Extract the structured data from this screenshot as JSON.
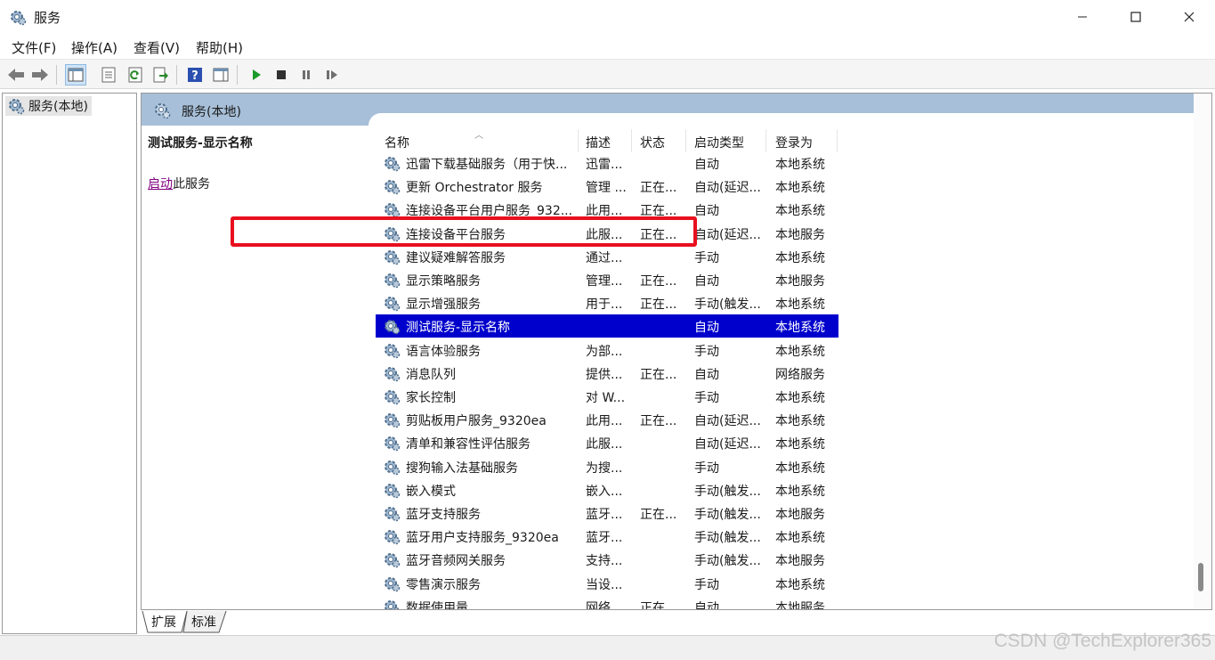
{
  "window": {
    "title": "服务"
  },
  "menu": [
    {
      "label": "文件(F)"
    },
    {
      "label": "操作(A)"
    },
    {
      "label": "查看(V)"
    },
    {
      "label": "帮助(H)"
    }
  ],
  "toolbar": {
    "icons": [
      "back-arrow-icon",
      "forward-arrow-icon",
      "show-hide-tree-icon",
      "properties-icon",
      "refresh-icon",
      "export-list-icon",
      "help-icon",
      "show-console-icon",
      "start-service-icon",
      "stop-service-icon",
      "pause-service-icon",
      "restart-service-icon"
    ],
    "colors": {
      "start": "#1a9a2a",
      "stop": "#303030",
      "help": "#2a4fb0"
    }
  },
  "tree": {
    "root_label": "服务(本地)"
  },
  "content": {
    "header_title": "服务(本地)",
    "selected_title": "测试服务-显示名称",
    "action_link": "启动",
    "action_suffix": "此服务"
  },
  "table": {
    "columns": [
      "名称",
      "描述",
      "状态",
      "启动类型",
      "登录为"
    ],
    "rows": [
      {
        "name": "迅雷下载基础服务（用于快...",
        "desc": "迅雷...",
        "status": "",
        "startup": "自动",
        "logon": "本地系统"
      },
      {
        "name": "更新 Orchestrator 服务",
        "desc": "管理 ...",
        "status": "正在...",
        "startup": "自动(延迟...",
        "logon": "本地系统"
      },
      {
        "name": "连接设备平台用户服务_932...",
        "desc": "此用...",
        "status": "正在...",
        "startup": "自动",
        "logon": "本地系统"
      },
      {
        "name": "连接设备平台服务",
        "desc": "此服...",
        "status": "正在...",
        "startup": "自动(延迟...",
        "logon": "本地服务"
      },
      {
        "name": "建议疑难解答服务",
        "desc": "通过...",
        "status": "",
        "startup": "手动",
        "logon": "本地系统"
      },
      {
        "name": "显示策略服务",
        "desc": "管理...",
        "status": "正在...",
        "startup": "自动",
        "logon": "本地服务"
      },
      {
        "name": "显示增强服务",
        "desc": "用于...",
        "status": "正在...",
        "startup": "手动(触发...",
        "logon": "本地系统"
      },
      {
        "name": "测试服务-显示名称",
        "desc": "",
        "status": "",
        "startup": "自动",
        "logon": "本地系统",
        "selected": true
      },
      {
        "name": "语言体验服务",
        "desc": "为部...",
        "status": "",
        "startup": "手动",
        "logon": "本地系统"
      },
      {
        "name": "消息队列",
        "desc": "提供...",
        "status": "正在...",
        "startup": "自动",
        "logon": "网络服务"
      },
      {
        "name": "家长控制",
        "desc": "对 W...",
        "status": "",
        "startup": "手动",
        "logon": "本地系统"
      },
      {
        "name": "剪贴板用户服务_9320ea",
        "desc": "此用...",
        "status": "正在...",
        "startup": "自动(延迟...",
        "logon": "本地系统"
      },
      {
        "name": "清单和兼容性评估服务",
        "desc": "此服...",
        "status": "",
        "startup": "自动(延迟...",
        "logon": "本地系统"
      },
      {
        "name": "搜狗输入法基础服务",
        "desc": "为搜...",
        "status": "",
        "startup": "手动",
        "logon": "本地系统"
      },
      {
        "name": "嵌入模式",
        "desc": "嵌入...",
        "status": "",
        "startup": "手动(触发...",
        "logon": "本地系统"
      },
      {
        "name": "蓝牙支持服务",
        "desc": "蓝牙...",
        "status": "正在...",
        "startup": "手动(触发...",
        "logon": "本地服务"
      },
      {
        "name": "蓝牙用户支持服务_9320ea",
        "desc": "蓝牙...",
        "status": "",
        "startup": "手动(触发...",
        "logon": "本地系统"
      },
      {
        "name": "蓝牙音频网关服务",
        "desc": "支持...",
        "status": "",
        "startup": "手动(触发...",
        "logon": "本地服务"
      },
      {
        "name": "零售演示服务",
        "desc": "当设...",
        "status": "",
        "startup": "手动",
        "logon": "本地系统"
      },
      {
        "name": "数据使用量",
        "desc": "网络...",
        "status": "正在...",
        "startup": "自动",
        "logon": "本地服务"
      }
    ],
    "selected_bg": "#0000cc",
    "highlight_border": "#e8101e"
  },
  "tabs": [
    {
      "label": "扩展",
      "active": true
    },
    {
      "label": "标准",
      "active": false
    }
  ],
  "watermark": "CSDN @TechExplorer365"
}
